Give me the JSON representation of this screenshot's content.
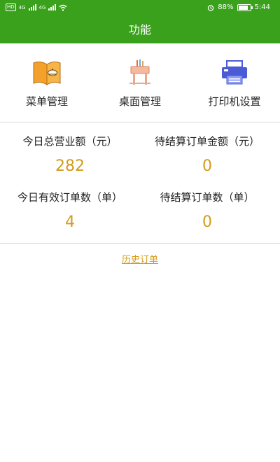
{
  "status_bar": {
    "hd_label": "HD",
    "signal_labels": [
      "4G",
      "4G"
    ],
    "battery": "88%",
    "battery_level": 0.88,
    "time": "5:44",
    "icons": [
      "alarm-icon",
      "wifi-icon",
      "battery-icon",
      "signal-icon"
    ]
  },
  "app_bar": {
    "title": "功能"
  },
  "features": [
    {
      "label": "菜单管理",
      "icon": "menu-book-icon"
    },
    {
      "label": "桌面管理",
      "icon": "table-icon"
    },
    {
      "label": "打印机设置",
      "icon": "printer-icon"
    }
  ],
  "stats": {
    "today_revenue": {
      "title": "今日总营业额（元）",
      "value": "282"
    },
    "pending_amount": {
      "title": "待结算订单金额（元）",
      "value": "0"
    },
    "today_orders": {
      "title": "今日有效订单数（单）",
      "value": "4"
    },
    "pending_orders": {
      "title": "待结算订单数（单）",
      "value": "0"
    }
  },
  "history_link": "历史订单",
  "colors": {
    "primary": "#3aa11d",
    "accent": "#d39b1c",
    "divider": "#d8d8d8"
  }
}
